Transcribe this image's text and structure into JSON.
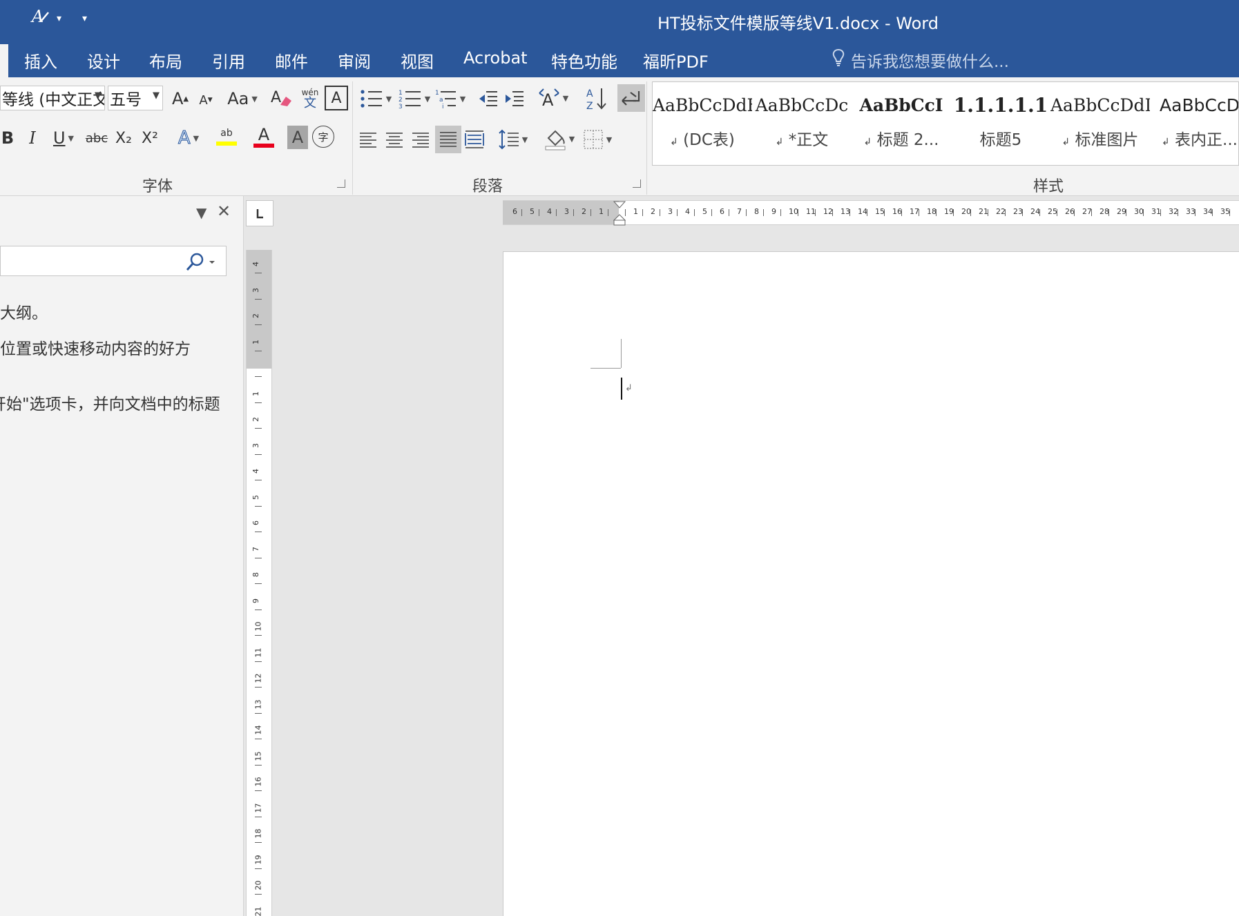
{
  "titlebar": {
    "title": "HT投标文件模版等线V1.docx - Word",
    "bg_color": "#2b579a"
  },
  "tabs": [
    "插入",
    "设计",
    "布局",
    "引用",
    "邮件",
    "审阅",
    "视图",
    "Acrobat",
    "特色功能",
    "福昕PDF"
  ],
  "tell_me": {
    "placeholder": "告诉我您想要做什么...",
    "icon": "lightbulb-icon"
  },
  "ribbon": {
    "font": {
      "font_name": "等线 (中文正文",
      "font_size": "五号",
      "grow_label": "A",
      "shrink_label": "A",
      "case_label": "Aa",
      "phonetic_top": "wén",
      "phonetic_bottom": "文",
      "border_char_label": "A",
      "bold": "B",
      "italic": "I",
      "underline": "U",
      "strike": "abc",
      "subscript": "X₂",
      "superscript": "X²",
      "text_effect": "A",
      "highlight": "ab",
      "font_color": "A",
      "char_shading": "A",
      "enclose": "字",
      "group_label": "字体"
    },
    "paragraph": {
      "group_label": "段落",
      "sort_label": "A Z"
    },
    "styles": {
      "group_label": "样式",
      "items": [
        {
          "sample": "AaBbCcDdE",
          "name": "(DC表)",
          "mark": "↲"
        },
        {
          "sample": "AaBbCcDc",
          "name": "*正文",
          "mark": "↲"
        },
        {
          "sample": "AaBbCcI",
          "name": "标题 2...",
          "mark": "↲"
        },
        {
          "sample": "1.1.1.1.1",
          "name": "标题5",
          "mark": ""
        },
        {
          "sample": "AaBbCcDdI",
          "name": "标准图片",
          "mark": "↲"
        },
        {
          "sample": "AaBbCcD",
          "name": "表内正...",
          "mark": "↲"
        }
      ]
    }
  },
  "navpane": {
    "tips": [
      "大纲。",
      "位置或快速移动内容的好方",
      "开始\"选项卡，并向文档中的标题"
    ]
  },
  "hruler": {
    "labels": [
      "6",
      "5",
      "4",
      "3",
      "2",
      "1",
      "",
      "1",
      "2",
      "3",
      "4",
      "5",
      "6",
      "7",
      "8",
      "9",
      "10",
      "11",
      "12",
      "13",
      "14",
      "15",
      "16",
      "17",
      "18",
      "19",
      "20",
      "21",
      "22",
      "23",
      "24",
      "25",
      "26",
      "27",
      "28",
      "29",
      "30",
      "31",
      "32",
      "33",
      "34",
      "35"
    ]
  },
  "vruler": {
    "labels": [
      "4",
      "3",
      "2",
      "1",
      "",
      "1",
      "2",
      "3",
      "4",
      "5",
      "6",
      "7",
      "8",
      "9",
      "10",
      "11",
      "12",
      "13",
      "14",
      "15",
      "16",
      "17",
      "18",
      "19",
      "20",
      "21"
    ]
  },
  "document": {
    "paragraph_mark": "↲"
  }
}
